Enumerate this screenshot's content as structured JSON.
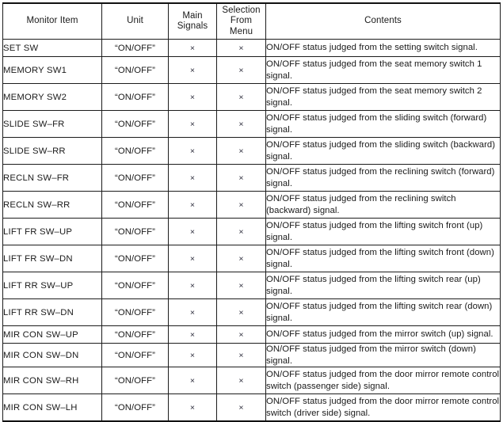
{
  "table": {
    "headers": {
      "monitor_item": "Monitor Item",
      "unit": "Unit",
      "main_signals_line1": "Main",
      "main_signals_line2": "Signals",
      "selection_line1": "Selection",
      "selection_line2": "From",
      "selection_line3": "Menu",
      "contents": "Contents"
    },
    "mark": "×",
    "rows": [
      {
        "item": "SET SW",
        "unit": "“ON/OFF”",
        "main_signals": "×",
        "selection_from_menu": "×",
        "contents": "ON/OFF status judged from the setting switch signal.",
        "lines": 1
      },
      {
        "item": "MEMORY SW1",
        "unit": "“ON/OFF”",
        "main_signals": "×",
        "selection_from_menu": "×",
        "contents": "ON/OFF status judged from the seat memory switch 1 signal.",
        "lines": 2
      },
      {
        "item": "MEMORY SW2",
        "unit": "“ON/OFF”",
        "main_signals": "×",
        "selection_from_menu": "×",
        "contents": "ON/OFF status judged from the seat memory switch 2 signal.",
        "lines": 2
      },
      {
        "item": "SLIDE SW–FR",
        "unit": "“ON/OFF”",
        "main_signals": "×",
        "selection_from_menu": "×",
        "contents": "ON/OFF status judged from the sliding switch (forward) signal.",
        "lines": 2
      },
      {
        "item": "SLIDE SW–RR",
        "unit": "“ON/OFF”",
        "main_signals": "×",
        "selection_from_menu": "×",
        "contents": "ON/OFF status judged from the sliding switch (backward) signal.",
        "lines": 2
      },
      {
        "item": "RECLN SW–FR",
        "unit": "“ON/OFF”",
        "main_signals": "×",
        "selection_from_menu": "×",
        "contents": "ON/OFF status judged from the reclining switch (forward) signal.",
        "lines": 2
      },
      {
        "item": "RECLN SW–RR",
        "unit": "“ON/OFF”",
        "main_signals": "×",
        "selection_from_menu": "×",
        "contents": "ON/OFF status judged from the reclining switch (backward) signal.",
        "lines": 2
      },
      {
        "item": "LIFT FR SW–UP",
        "unit": "“ON/OFF”",
        "main_signals": "×",
        "selection_from_menu": "×",
        "contents": "ON/OFF status judged from the lifting switch front (up) signal.",
        "lines": 2
      },
      {
        "item": "LIFT FR SW–DN",
        "unit": "“ON/OFF”",
        "main_signals": "×",
        "selection_from_menu": "×",
        "contents": "ON/OFF status judged from the lifting switch front (down) signal.",
        "lines": 2
      },
      {
        "item": "LIFT RR SW–UP",
        "unit": "“ON/OFF”",
        "main_signals": "×",
        "selection_from_menu": "×",
        "contents": "ON/OFF status judged from the lifting switch rear (up) signal.",
        "lines": 2
      },
      {
        "item": "LIFT RR SW–DN",
        "unit": "“ON/OFF”",
        "main_signals": "×",
        "selection_from_menu": "×",
        "contents": "ON/OFF status judged from the lifting switch rear (down) signal.",
        "lines": 2
      },
      {
        "item": "MIR CON SW–UP",
        "unit": "“ON/OFF”",
        "main_signals": "×",
        "selection_from_menu": "×",
        "contents": "ON/OFF status judged from the mirror switch (up) signal.",
        "lines": 1
      },
      {
        "item": "MIR CON SW–DN",
        "unit": "“ON/OFF”",
        "main_signals": "×",
        "selection_from_menu": "×",
        "contents": "ON/OFF status judged from the mirror switch (down) signal.",
        "lines": 1
      },
      {
        "item": "MIR CON SW–RH",
        "unit": "“ON/OFF”",
        "main_signals": "×",
        "selection_from_menu": "×",
        "contents": "ON/OFF status judged from the door mirror remote control switch (passenger side) signal.",
        "lines": 2
      },
      {
        "item": "MIR CON SW–LH",
        "unit": "“ON/OFF”",
        "main_signals": "×",
        "selection_from_menu": "×",
        "contents": "ON/OFF status judged from the door mirror remote control switch (driver side) signal.",
        "lines": 2
      }
    ]
  }
}
